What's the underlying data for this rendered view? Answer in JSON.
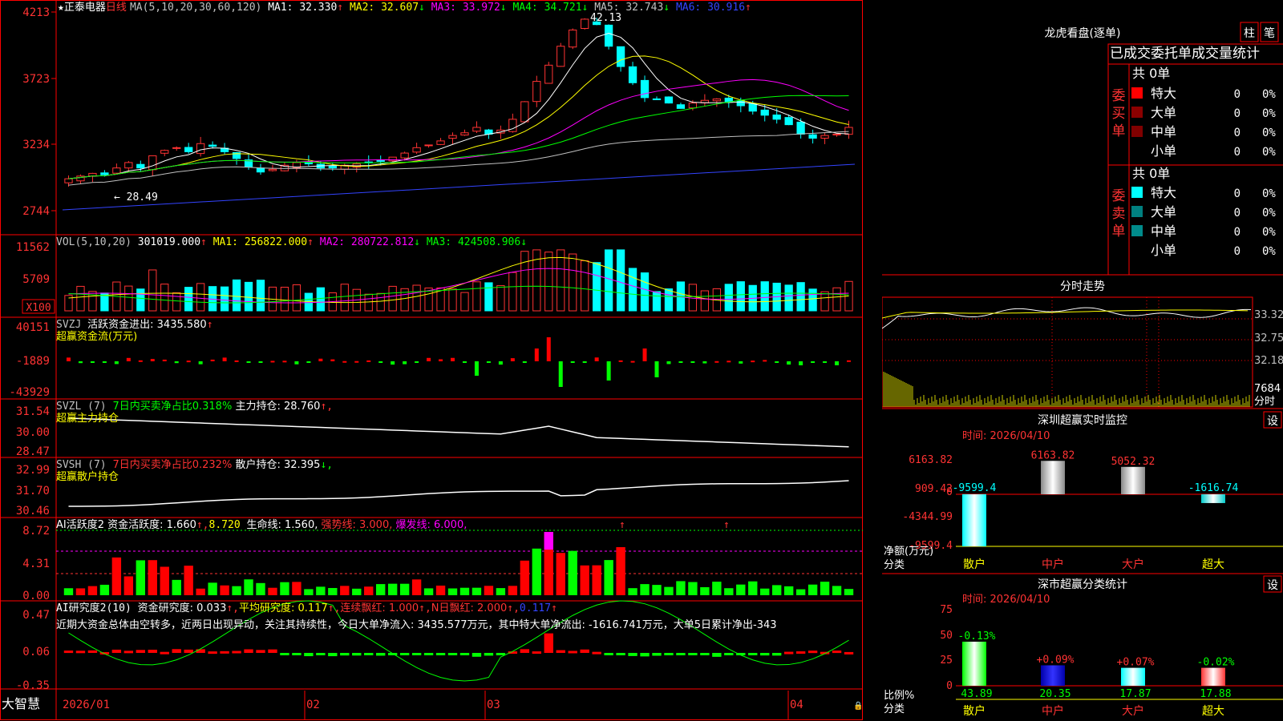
{
  "stock": {
    "star": "★",
    "name": "正泰电器",
    "period": "日线"
  },
  "ma_header": [
    {
      "text": "MA(5,10,20,30,60,120)",
      "color": "#c0c0c0"
    },
    {
      "text": "MA1: 32.330",
      "color": "#ffffff",
      "arrow": "↑",
      "arrow_color": "#ff3333"
    },
    {
      "text": "MA2: 32.607",
      "color": "#ffff00",
      "arrow": "↓",
      "arrow_color": "#00ff00"
    },
    {
      "text": "MA3: 33.972",
      "color": "#ff00ff",
      "arrow": "↓",
      "arrow_color": "#00ff00"
    },
    {
      "text": "MA4: 34.721",
      "color": "#00ff00",
      "arrow": "↓",
      "arrow_color": "#00ff00"
    },
    {
      "text": "MA5: 32.743",
      "color": "#c0c0c0",
      "arrow": "↓",
      "arrow_color": "#00ff00"
    },
    {
      "text": "MA6: 30.916",
      "color": "#3344ff",
      "arrow": "↑",
      "arrow_color": "#ff3333"
    }
  ],
  "price_axis": [
    "4213",
    "3723",
    "3234",
    "2744"
  ],
  "price_annotations": {
    "high": "42.13",
    "low": "28.49"
  },
  "vol_header": [
    {
      "text": "VOL(5,10,20)",
      "color": "#c0c0c0"
    },
    {
      "text": "301019.000",
      "color": "#ffffff",
      "arrow": "↑",
      "arrow_color": "#ff3333"
    },
    {
      "text": "MA1: 256822.000",
      "color": "#ffff00",
      "arrow": "↑",
      "arrow_color": "#ff3333"
    },
    {
      "text": "MA2: 280722.812",
      "color": "#ff00ff",
      "arrow": "↓",
      "arrow_color": "#00ff00"
    },
    {
      "text": "MA3: 424508.906",
      "color": "#00ff00",
      "arrow": "↓",
      "arrow_color": "#00ff00"
    }
  ],
  "vol_axis": [
    "11562",
    "5709"
  ],
  "vol_unit": "X100",
  "svzj": {
    "title": "SVZJ",
    "line1": "活跃资金进出: 3435.580",
    "arrow": "↑",
    "line2": "超赢资金流(万元)",
    "axis": [
      "40151",
      "-1889",
      "-43929"
    ]
  },
  "svzl": {
    "title": "SVZL (7)",
    "desc": "7日内买卖净占比0.318%",
    "value": "主力持仓: 28.760",
    "arrow": "↑,",
    "line2": "超赢主力持仓",
    "axis": [
      "31.54",
      "30.00",
      "28.47"
    ]
  },
  "svsh": {
    "title": "SVSH (7)",
    "desc": "7日内买卖净占比0.232%",
    "value": "散户持仓: 32.395",
    "arrow": "↓,",
    "line2": "超赢散户持仓",
    "axis": [
      "32.99",
      "31.70",
      "30.46"
    ]
  },
  "ai1": {
    "title": "AI活跃度2 资金活跃度: 1.660",
    "v2": "8.720",
    "v3": "生命线: 1.560,",
    "v4": "强势线: 3.000,",
    "v5": "爆发线: 6.000,",
    "axis": [
      "8.72",
      "4.31",
      "0.00"
    ]
  },
  "ai2": {
    "title": "AI研究度2(10)",
    "v1": "资金研究度: 0.033",
    "v2": "平均研究度: 0.117",
    "v3": "连续飘红: 1.000",
    "v4": "N日飘红: 2.000",
    "v5": "0.117",
    "note": "近期大资金总体由空转多，近两日出现异动，关注其持续性，今日大单净流入: 3435.577万元，其中特大单净流出: -1616.741万元，大单5日累计净出-343",
    "axis": [
      "0.47",
      "0.06",
      "-0.35"
    ]
  },
  "date_axis": {
    "start": "2026/01",
    "labels": [
      "02",
      "03",
      "04"
    ]
  },
  "brand": "大智慧",
  "side": {
    "dragon_title": "龙虎看盘(逐单)",
    "btn_pillar": "柱",
    "btn_pen": "笔",
    "stats_title": "已成交委托单成交量统计",
    "buy_label": "委买单",
    "sell_label": "委卖单",
    "buy_total": "共 0单",
    "sell_total": "共 0单",
    "buy_rows": [
      {
        "label": "特大",
        "color": "#ff0000",
        "count": "0",
        "pct": "0%"
      },
      {
        "label": "大单",
        "color": "#8b0000",
        "count": "0",
        "pct": "0%"
      },
      {
        "label": "中单",
        "color": "#800000",
        "count": "0",
        "pct": "0%"
      },
      {
        "label": "小单",
        "color": "",
        "count": "0",
        "pct": "0%"
      }
    ],
    "sell_rows": [
      {
        "label": "特大",
        "color": "#00ffff",
        "count": "0",
        "pct": "0%"
      },
      {
        "label": "大单",
        "color": "#008080",
        "count": "0",
        "pct": "0%"
      },
      {
        "label": "中单",
        "color": "#008b8b",
        "count": "0",
        "pct": "0%"
      },
      {
        "label": "小单",
        "color": "",
        "count": "0",
        "pct": "0%"
      }
    ],
    "intraday_title": "分时走势",
    "intraday_axis": [
      "33.32",
      "32.75",
      "32.18",
      "7684",
      "分时"
    ],
    "monitor_title": "深圳超赢实时监控",
    "monitor_btn": "设",
    "monitor_time": "时间: 2026/04/10",
    "monitor_axis": [
      "6163.82",
      "909.42",
      "0",
      "-4344.99",
      "-9599.4"
    ],
    "monitor_unit_label1": "净额(万元)",
    "monitor_unit_label2": "分类",
    "monitor_values": [
      "-9599.4",
      "6163.82",
      "5052.32",
      "-1616.74"
    ],
    "categories": [
      "散户",
      "中户",
      "大户",
      "超大"
    ],
    "stat_title": "深市超赢分类统计",
    "stat_btn": "设",
    "stat_time": "时间: 2026/04/10",
    "stat_axis": [
      "75",
      "50",
      "25",
      "0"
    ],
    "stat_unit1": "比例%",
    "stat_unit2": "分类",
    "stat_top": [
      "-0.13%",
      "+0.09%",
      "+0.07%",
      "-0.02%"
    ],
    "stat_bottom": [
      "43.89",
      "20.35",
      "17.87",
      "17.88"
    ]
  },
  "colors": {
    "up": "#ff3333",
    "down": "#00ffff",
    "grid": "#ff0000",
    "bg": "#000000"
  }
}
